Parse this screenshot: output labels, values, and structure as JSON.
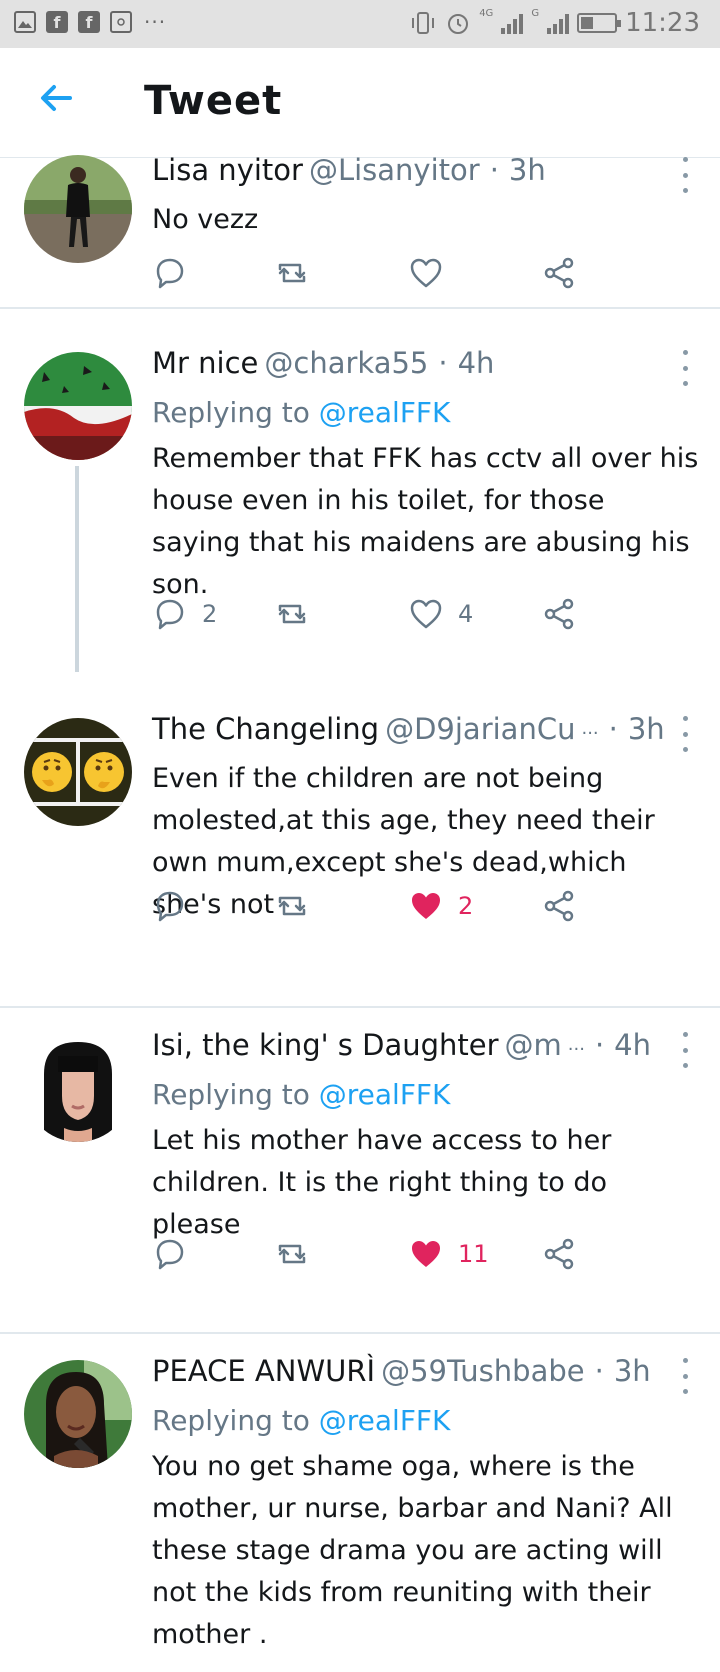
{
  "status_bar": {
    "time": "11:23",
    "network_1": "4G",
    "network_2": "G",
    "more": "···"
  },
  "header": {
    "title": "Tweet"
  },
  "colors": {
    "accent": "#1da1f2",
    "like": "#e0245e",
    "secondary_text": "#657786"
  },
  "tweets": [
    {
      "name": "Lisa nyitor",
      "handle": "@Lisanyitor",
      "dot": "·",
      "time": "3h",
      "text": "No vezz",
      "reply_count": "",
      "like_count": ""
    },
    {
      "name": "Mr nice",
      "handle": "@charka55",
      "dot": "·",
      "time": "4h",
      "reply_prefix": "Replying to",
      "reply_to": "@realFFK",
      "text": "Remember that FFK has cctv all over his house even in his toilet, for those saying that his maidens are abusing his son.",
      "reply_count": "2",
      "like_count": "4"
    },
    {
      "name": "The Changeling",
      "handle": "@D9jarianCu",
      "ellipsis": "···",
      "dot": "·",
      "time": "3h",
      "text": "Even if the children are not being molested,at this age, they need their own mum,except she's dead,which she's not",
      "reply_count": "",
      "like_count": "2"
    },
    {
      "name": "Isi, the king' s Daughter",
      "handle": "@m",
      "ellipsis": "···",
      "dot": "·",
      "time": "4h",
      "reply_prefix": "Replying to",
      "reply_to": "@realFFK",
      "text": "Let his mother have access to her children. It is the right thing to do please",
      "reply_count": "",
      "like_count": "11"
    },
    {
      "name": "PEACE ANWURÌ",
      "handle": "@59Tushbabe",
      "dot": "·",
      "time": "3h",
      "reply_prefix": "Replying to",
      "reply_to": "@realFFK",
      "text": "You no get shame oga, where is the mother, ur nurse, barbar and Nani? All these stage drama you are acting will not the kids from reuniting with their mother ."
    }
  ]
}
